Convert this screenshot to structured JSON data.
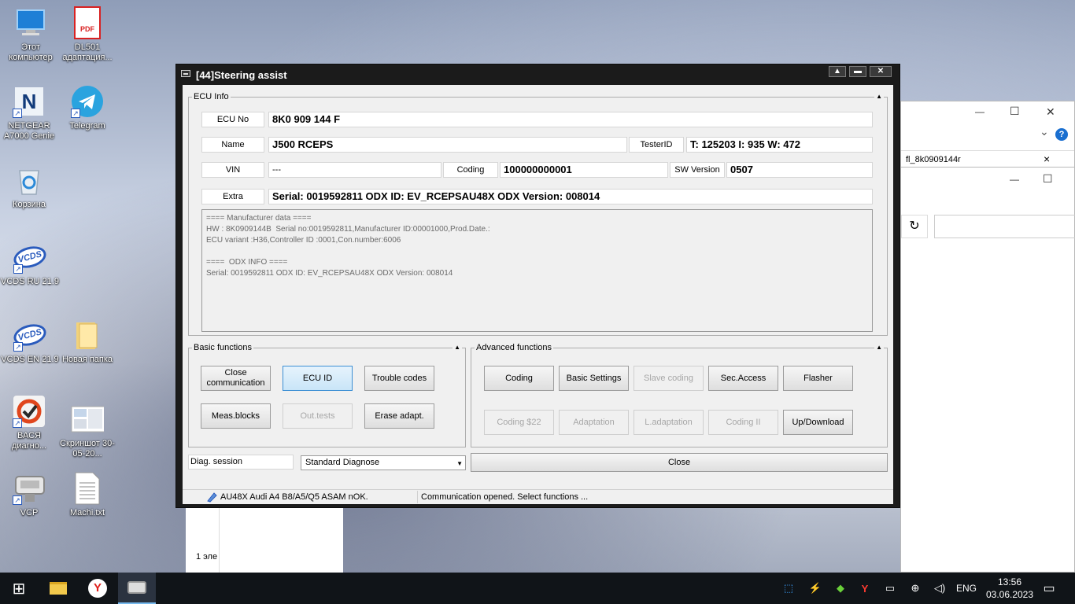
{
  "desktop": {
    "icons": [
      {
        "label": "Этот компьютер"
      },
      {
        "label": "DL501 адаптация..."
      },
      {
        "label": "NETGEAR A7000 Genie"
      },
      {
        "label": "Telegram"
      },
      {
        "label": "Корзина"
      },
      {
        "label": "VCDS RU 21.9"
      },
      {
        "label": "VCDS EN 21.9"
      },
      {
        "label": "Новая папка"
      },
      {
        "label": "ВАСЯ диагно..."
      },
      {
        "label": "Скриншот 30-05-20..."
      },
      {
        "label": "VCP"
      },
      {
        "label": "Machi.txt"
      }
    ],
    "pdf_badge": "PDF",
    "vcds_badge": "VCDS",
    "netgear_badge": "N"
  },
  "bg_window": {
    "tab_title": "fl_8k0909144r",
    "tab_close": "×",
    "refresh": "↻",
    "help": "?",
    "chevron": "⌄",
    "min": "—",
    "max": "☐",
    "close": "✕",
    "item_count": "1 эле"
  },
  "window": {
    "title": "[44]Steering assist",
    "btn_restore": "▲",
    "btn_minimize": "▬",
    "btn_close": "✕"
  },
  "ecu_info": {
    "group_label": "ECU Info",
    "collapse_arrow": "▲",
    "ecu_no_label": "ECU No",
    "ecu_no": "8K0 909 144 F",
    "name_label": "Name",
    "name": "J500  RCEPS",
    "tester_id_label": "TesterID",
    "tester_id": "T: 125203 I: 935 W: 472",
    "vin_label": "VIN",
    "vin": "---",
    "coding_label": "Coding",
    "coding": "100000000001",
    "sw_version_label": "SW Version",
    "sw_version": "0507",
    "extra_label": "Extra",
    "extra": "Serial: 0019592811 ODX ID: EV_RCEPSAU48X ODX Version: 008014",
    "details": [
      "==== Manufacturer data ====",
      "HW : 8K0909144B  Serial no:0019592811,Manufacturer ID:00001000,Prod.Date.:",
      "ECU variant :H36,Controller ID :0001,Con.number:6006",
      "",
      "====  ODX INFO ====",
      "Serial: 0019592811 ODX ID: EV_RCEPSAU48X ODX Version: 008014"
    ]
  },
  "basic_functions": {
    "group_label": "Basic functions",
    "collapse_arrow": "▲",
    "close_communication": "Close communication",
    "ecu_id": "ECU ID",
    "trouble_codes": "Trouble codes",
    "meas_blocks": "Meas.blocks",
    "out_tests": "Out.tests",
    "erase_adapt": "Erase adapt."
  },
  "advanced_functions": {
    "group_label": "Advanced functions",
    "collapse_arrow": "▲",
    "coding": "Coding",
    "basic_settings": "Basic Settings",
    "slave_coding": "Slave coding",
    "sec_access": "Sec.Access",
    "flasher": "Flasher",
    "coding_22": "Coding $22",
    "adaptation": "Adaptation",
    "l_adaptation": "L.adaptation",
    "coding_ii": "Coding II",
    "up_download": "Up/Download"
  },
  "session": {
    "label": "Diag. session",
    "selected": "Standard Diagnose",
    "dropdown_arrow": "▼",
    "close_button": "Close"
  },
  "statusbar": {
    "interface": "AU48X Audi A4 B8/A5/Q5 ASAM nOK.",
    "message": "Communication opened. Select functions ..."
  },
  "taskbar": {
    "start": "⊞",
    "yandex": "Y",
    "lang": "ENG",
    "time": "13:56",
    "date": "03.06.2023",
    "notif": "▭",
    "tray_icons": [
      "⬚",
      "⚡",
      "◆",
      "Y",
      "▭",
      "⊕",
      "◁)"
    ]
  },
  "colors": {
    "accent": "#3c8fd4",
    "window_frame": "#1b1b1b",
    "client_bg": "#f0f0f0",
    "taskbar_bg": "#101418"
  }
}
